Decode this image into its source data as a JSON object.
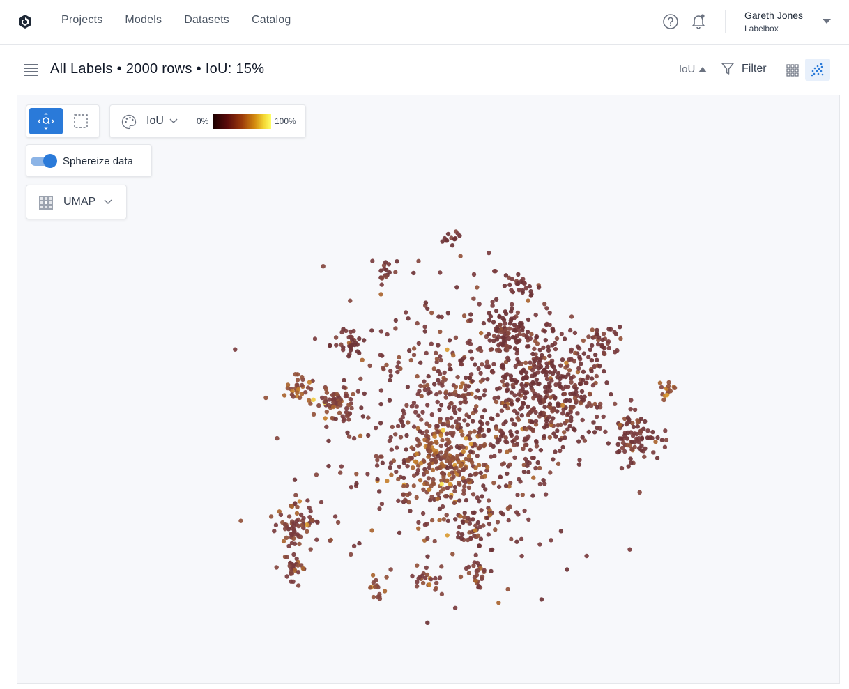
{
  "nav": {
    "items": [
      "Projects",
      "Models",
      "Datasets",
      "Catalog"
    ]
  },
  "user": {
    "name": "Gareth Jones",
    "org": "Labelbox"
  },
  "header": {
    "title": "All Labels • 2000 rows • IoU: 15%",
    "sort_label": "IoU",
    "filter_label": "Filter",
    "active_view": "scatter"
  },
  "toolbar": {
    "active_tool": "pan-zoom",
    "color_by": "IoU",
    "legend_min": "0%",
    "legend_max": "100%",
    "sphereize_label": "Sphereize data",
    "sphereize_on": true,
    "projection": "UMAP"
  },
  "chart_data": {
    "type": "scatter",
    "title": "",
    "xlabel": "",
    "ylabel": "",
    "point_count": 2000,
    "color_metric": "IoU",
    "color_range": [
      0,
      100
    ],
    "colormap": [
      "#1a0000",
      "#5a0b0b",
      "#9b3a0a",
      "#d38a10",
      "#f4d834",
      "#ffff66"
    ],
    "dominant_color": "#7a3a3c",
    "grid": false,
    "legend": "top-left",
    "clusters": [
      {
        "cx": 0.0,
        "cy": 0.0,
        "spread": 2.6,
        "n": 620,
        "iou_mean": 0.15
      },
      {
        "cx": 1.6,
        "cy": 0.6,
        "spread": 1.3,
        "n": 380,
        "iou_mean": 0.1
      },
      {
        "cx": -0.2,
        "cy": -0.7,
        "spread": 0.9,
        "n": 180,
        "iou_mean": 0.35
      },
      {
        "cx": -2.9,
        "cy": -1.9,
        "spread": 0.45,
        "n": 70,
        "iou_mean": 0.2
      },
      {
        "cx": -3.0,
        "cy": -2.7,
        "spread": 0.3,
        "n": 30,
        "iou_mean": 0.22
      },
      {
        "cx": -2.2,
        "cy": 0.3,
        "spread": 0.45,
        "n": 60,
        "iou_mean": 0.25
      },
      {
        "cx": -2.9,
        "cy": 0.6,
        "spread": 0.3,
        "n": 30,
        "iou_mean": 0.4
      },
      {
        "cx": 0.9,
        "cy": 1.7,
        "spread": 0.4,
        "n": 70,
        "iou_mean": 0.08
      },
      {
        "cx": 3.3,
        "cy": -0.3,
        "spread": 0.5,
        "n": 80,
        "iou_mean": 0.08
      },
      {
        "cx": 3.9,
        "cy": 0.6,
        "spread": 0.2,
        "n": 15,
        "iou_mean": 0.4
      },
      {
        "cx": 2.7,
        "cy": 1.5,
        "spread": 0.35,
        "n": 30,
        "iou_mean": 0.08
      },
      {
        "cx": 1.2,
        "cy": 2.5,
        "spread": 0.3,
        "n": 25,
        "iou_mean": 0.1
      },
      {
        "cx": -0.5,
        "cy": -2.9,
        "spread": 0.25,
        "n": 20,
        "iou_mean": 0.15
      },
      {
        "cx": 0.4,
        "cy": -2.8,
        "spread": 0.3,
        "n": 25,
        "iou_mean": 0.2
      },
      {
        "cx": -1.5,
        "cy": -3.1,
        "spread": 0.2,
        "n": 15,
        "iou_mean": 0.3
      },
      {
        "cx": -2.0,
        "cy": 1.5,
        "spread": 0.35,
        "n": 30,
        "iou_mean": 0.1
      },
      {
        "cx": -1.3,
        "cy": 2.8,
        "spread": 0.2,
        "n": 15,
        "iou_mean": 0.1
      },
      {
        "cx": -0.1,
        "cy": 3.4,
        "spread": 0.15,
        "n": 12,
        "iou_mean": 0.1
      },
      {
        "cx": 0.3,
        "cy": -1.9,
        "spread": 0.35,
        "n": 40,
        "iou_mean": 0.15
      }
    ]
  }
}
